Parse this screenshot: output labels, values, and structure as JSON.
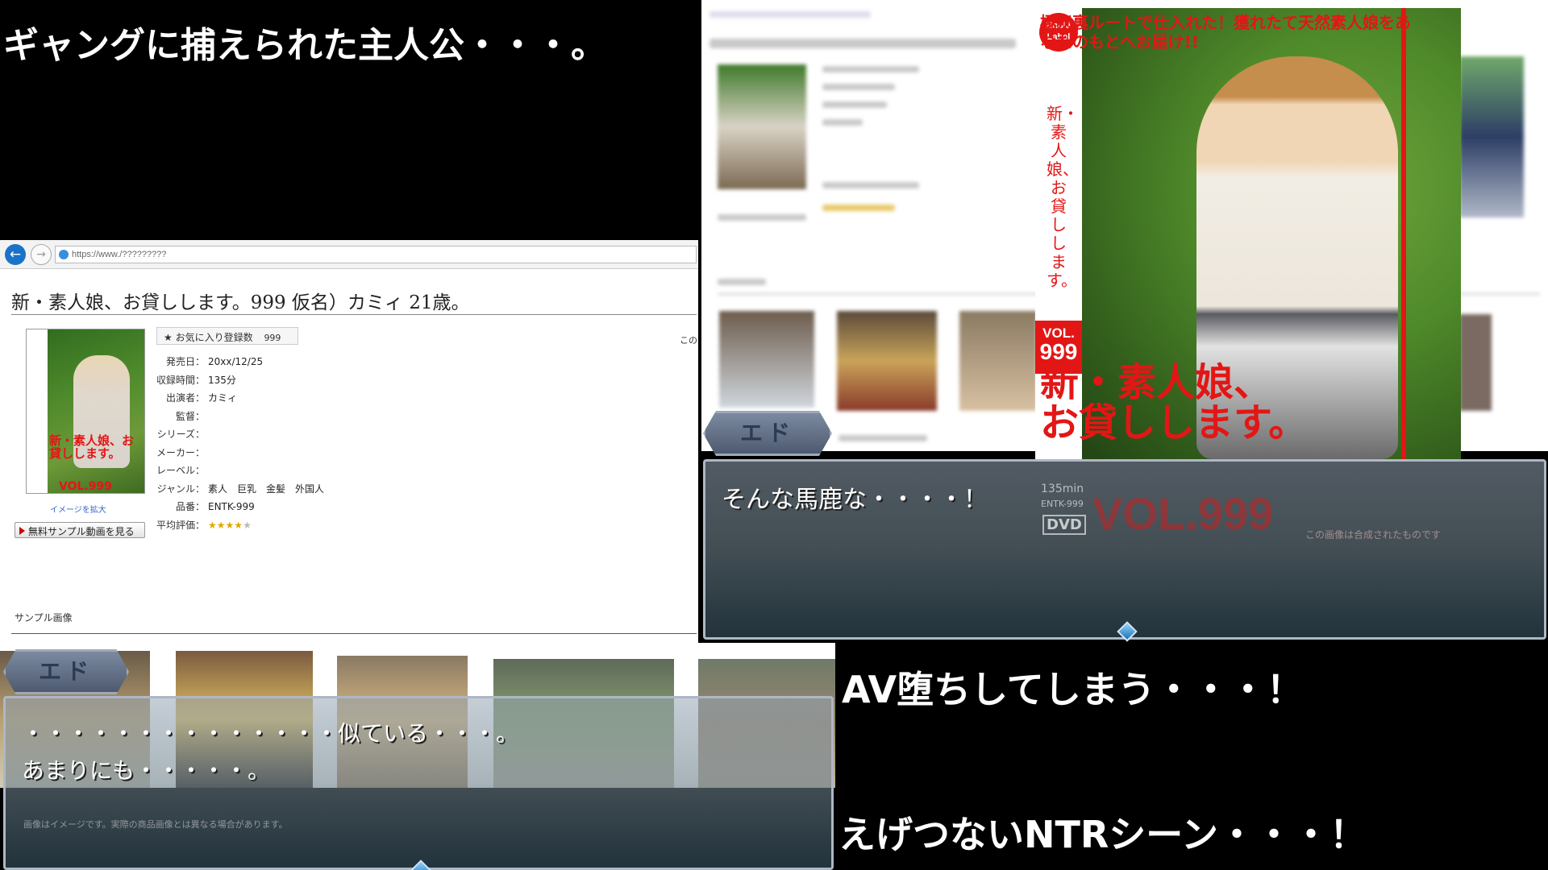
{
  "captions": {
    "top_left": "ギャングに捕えられた主人公・・・。",
    "mid_right": "AV堕ちしてしまう・・・！",
    "bottom_right": "えげつないNTRシーン・・・！"
  },
  "browser": {
    "url": "https://www./?????????",
    "page_title": "新・素人娘、お貸しします。999 仮名）カミィ 21歳。",
    "favorite_label": "お気に入り登録数",
    "favorite_count": "999",
    "image_enlarge_link": "イメージを拡大",
    "sample_movie_button": "無料サンプル動画を見る",
    "cover_title": "新・素人娘、お貸しします。",
    "cover_vol": "VOL.999",
    "details": [
      {
        "key": "発売日：",
        "value": "20xx/12/25"
      },
      {
        "key": "収録時間：",
        "value": "135分"
      },
      {
        "key": "出演者：",
        "value": "カミィ"
      },
      {
        "key": "監督：",
        "value": ""
      },
      {
        "key": "シリーズ：",
        "value": ""
      },
      {
        "key": "メーカー：",
        "value": ""
      },
      {
        "key": "レーベル：",
        "value": ""
      },
      {
        "key": "ジャンル：",
        "value": "素人　巨乳　金髪　外国人"
      },
      {
        "key": "品番：",
        "value": "ENTK-999"
      },
      {
        "key": "平均評価：",
        "value": ""
      }
    ],
    "rating_stars": 4,
    "cut_text": "この",
    "sample_images_header": "サンプル画像"
  },
  "ad_cover": {
    "logo": "Enoki Label",
    "top_text": "極秘裏ルートで仕入れた！獲れたて天然素人娘をあなたのもとへお届け!!",
    "vertical_title": "新・素人娘、お貸しします。",
    "vol_label": "VOL.",
    "vol_number": "999",
    "big_title_line1": "新・素人娘、",
    "big_title_line2": "お貸しします。",
    "bottom_vol": "VOL.999",
    "duration": "135min",
    "code": "ENTK-999",
    "dvd": "DVD",
    "disclaimer": "この画像は合成されたものです"
  },
  "dialog_right": {
    "speaker": "エド",
    "text": "そんな馬鹿な・・・・！"
  },
  "dialog_left": {
    "speaker": "エド",
    "line1": "・・・・・・・・・・・・・・似ている・・・。",
    "line2": "あまりにも・・・・・。",
    "footnote": "画像はイメージです。実際の商品画像とは異なる場合があります。"
  },
  "colors": {
    "accent_red": "#e31616",
    "link_blue": "#3366cc",
    "dialog_border": "#aeb7c4"
  }
}
